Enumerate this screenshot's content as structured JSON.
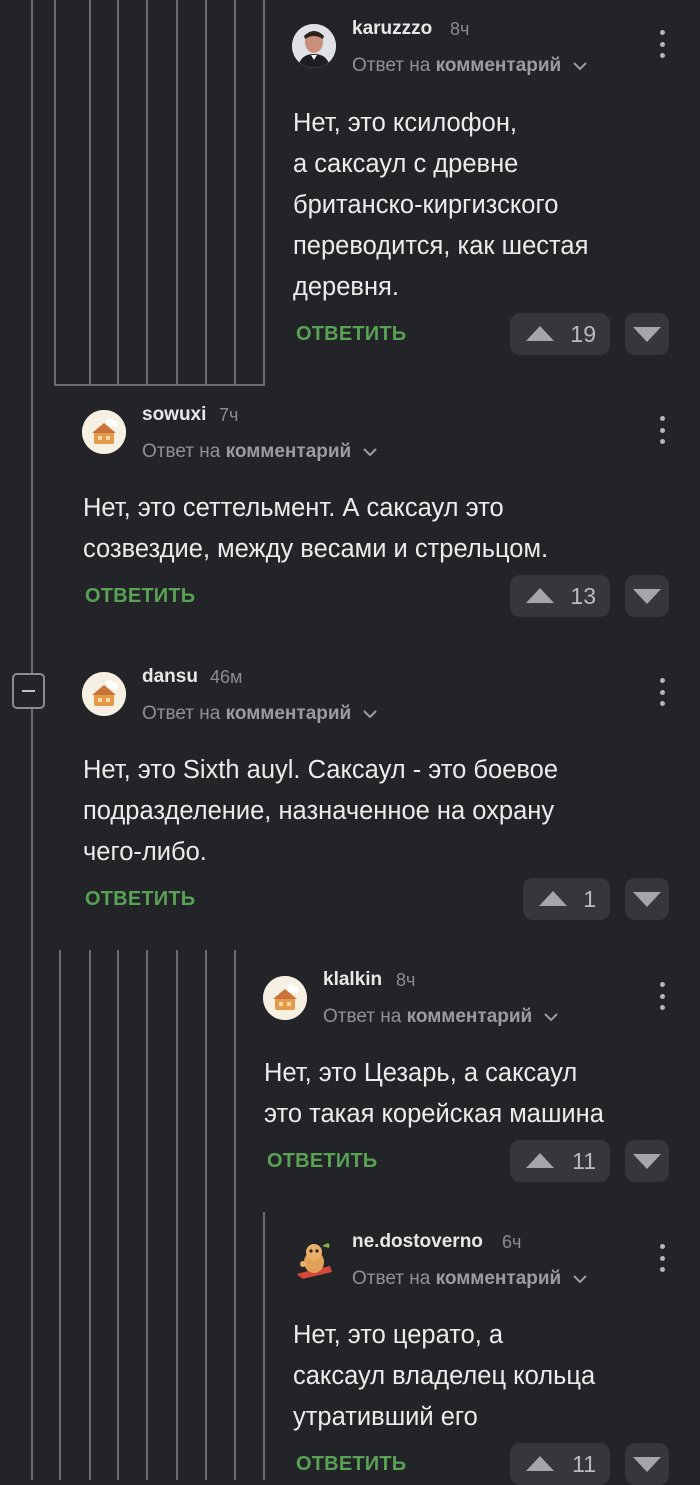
{
  "comments": [
    {
      "username": "karuzzzo",
      "time": "8ч",
      "reply_prefix": "Ответ на",
      "reply_target": "комментарий",
      "lines": [
        "Нет, это ксилофон,",
        "а саксаул с древне",
        "британско-киргизского",
        "переводится, как шестая",
        "деревня."
      ],
      "reply_label": "ОТВЕТИТЬ",
      "votes": "19",
      "avatar_icon": "user-photo-avatar"
    },
    {
      "username": "sowuxi",
      "time": "7ч",
      "reply_prefix": "Ответ на",
      "reply_target": "комментарий",
      "lines": [
        "Нет, это сеттельмент. А саксаул это",
        "созвездие, между весами и стрельцом."
      ],
      "reply_label": "ОТВЕТИТЬ",
      "votes": "13",
      "avatar_icon": "default-cat-avatar"
    },
    {
      "username": "dansu",
      "time": "46м",
      "reply_prefix": "Ответ на",
      "reply_target": "комментарий",
      "lines": [
        "Нет, это Sixth auyl. Саксаул - это боевое",
        "подразделение, назначенное на охрану",
        "чего-либо."
      ],
      "reply_label": "ОТВЕТИТЬ",
      "votes": "1",
      "avatar_icon": "default-cat-avatar"
    },
    {
      "username": "klalkin",
      "time": "8ч",
      "reply_prefix": "Ответ на",
      "reply_target": "комментарий",
      "lines": [
        "Нет, это Цезарь, а саксаул",
        "это такая корейская машина"
      ],
      "reply_label": "ОТВЕТИТЬ",
      "votes": "11",
      "avatar_icon": "default-cat-avatar"
    },
    {
      "username": "ne.dostoverno",
      "time": "6ч",
      "reply_prefix": "Ответ на",
      "reply_target": "комментарий",
      "lines": [
        "Нет, это церато, а",
        "саксаул владелец кольца",
        "утративший его"
      ],
      "reply_label": "ОТВЕТИТЬ",
      "votes": "11",
      "avatar_icon": "cartoon-character-avatar"
    }
  ],
  "colors": {
    "background": "#222428",
    "reply_green": "#59a154",
    "vote_bg": "#35373c",
    "thread_line": "#6a6c70"
  }
}
